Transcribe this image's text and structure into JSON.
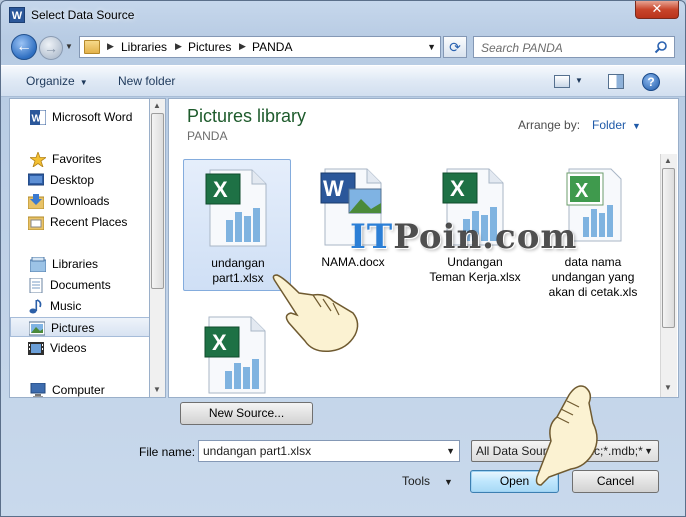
{
  "window": {
    "title": "Select Data Source",
    "close_glyph": "✕",
    "app_icon_letter": "W"
  },
  "address": {
    "crumbs": [
      "Libraries",
      "Pictures",
      "PANDA"
    ]
  },
  "search": {
    "placeholder": "Search PANDA"
  },
  "toolbar": {
    "organize": "Organize",
    "new_folder": "New folder"
  },
  "sidebar": {
    "items": [
      {
        "label": "Microsoft Word",
        "icon": "word-icon"
      },
      {
        "label": "Favorites",
        "icon": "star-icon"
      },
      {
        "label": "Desktop",
        "icon": "desktop-icon"
      },
      {
        "label": "Downloads",
        "icon": "downloads-icon"
      },
      {
        "label": "Recent Places",
        "icon": "recent-places-icon"
      },
      {
        "label": "Libraries",
        "icon": "libraries-icon"
      },
      {
        "label": "Documents",
        "icon": "documents-icon"
      },
      {
        "label": "Music",
        "icon": "music-icon"
      },
      {
        "label": "Pictures",
        "icon": "pictures-icon",
        "selected": true
      },
      {
        "label": "Videos",
        "icon": "videos-icon"
      },
      {
        "label": "Computer",
        "icon": "computer-icon"
      }
    ]
  },
  "library": {
    "title": "Pictures library",
    "subtitle": "PANDA",
    "arrange_label": "Arrange by:",
    "arrange_value": "Folder"
  },
  "files": [
    {
      "name_lines": [
        "undangan",
        "part1.xlsx"
      ],
      "type": "excel",
      "selected": true
    },
    {
      "name_lines": [
        "NAMA.docx"
      ],
      "type": "word",
      "selected": false
    },
    {
      "name_lines": [
        "Undangan",
        "Teman Kerja.xlsx"
      ],
      "type": "excel",
      "selected": false
    },
    {
      "name_lines": [
        "data nama",
        "undangan yang",
        "akan di cetak.xls"
      ],
      "type": "excel-old",
      "selected": false
    },
    {
      "name_lines": [
        ""
      ],
      "type": "excel",
      "selected": false
    }
  ],
  "watermark": {
    "text_a": "IT",
    "text_b": "Poin.com"
  },
  "buttons": {
    "new_source": "New Source...",
    "open": "Open",
    "cancel": "Cancel",
    "tools": "Tools"
  },
  "filename": {
    "label": "File name:",
    "value": "undangan part1.xlsx"
  },
  "filetype": {
    "value": "All Data Sources (*.odc;*.mdb;*"
  },
  "colors": {
    "accent": "#1f5aa8",
    "library_title": "#1e5b2c",
    "excel_green": "#1e7145",
    "word_blue": "#2b579a"
  }
}
